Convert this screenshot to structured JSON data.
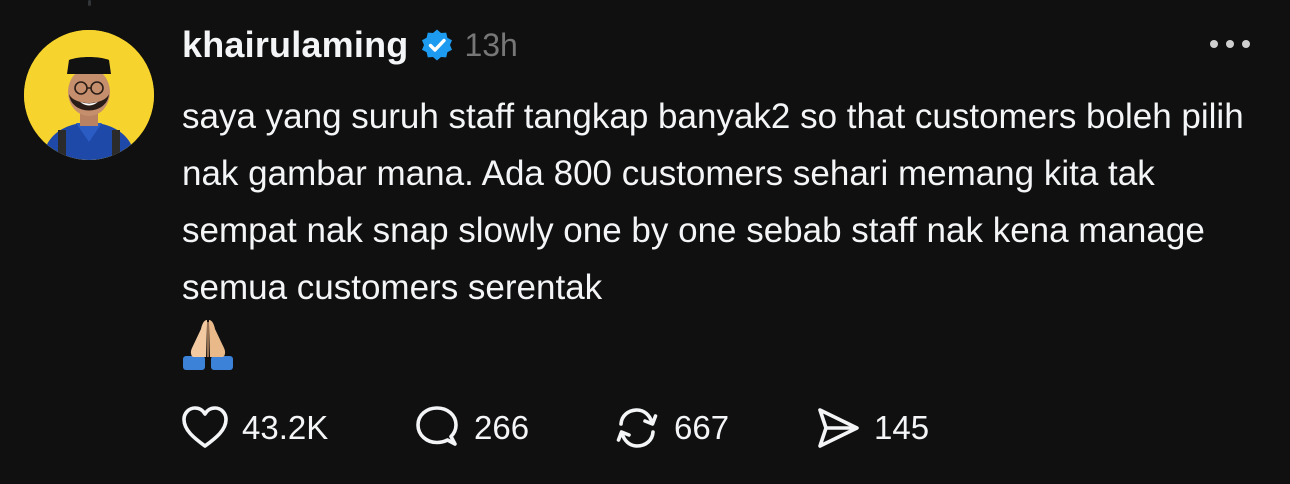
{
  "post": {
    "username": "khairulaming",
    "verified_icon": "verified-badge-icon",
    "timestamp": "13h",
    "text": "saya yang suruh staff tangkap banyak2 so that customers boleh pilih nak gambar mana. Ada 800 customers sehari memang kita tak sempat nak snap slowly one by one sebab staff nak kena manage semua customers serentak",
    "emoji": "folded-hands-emoji"
  },
  "actions": {
    "like_count": "43.2K",
    "reply_count": "266",
    "repost_count": "667",
    "share_count": "145"
  },
  "icons": {
    "like": "heart-icon",
    "reply": "comment-bubble-icon",
    "repost": "repost-arrows-icon",
    "share": "send-icon",
    "more": "more-options-icon"
  },
  "colors": {
    "background": "#101010",
    "text": "#f3f5f7",
    "muted": "#777777",
    "verified": "#1d9bf0",
    "avatar_bg": "#f6d32d"
  }
}
